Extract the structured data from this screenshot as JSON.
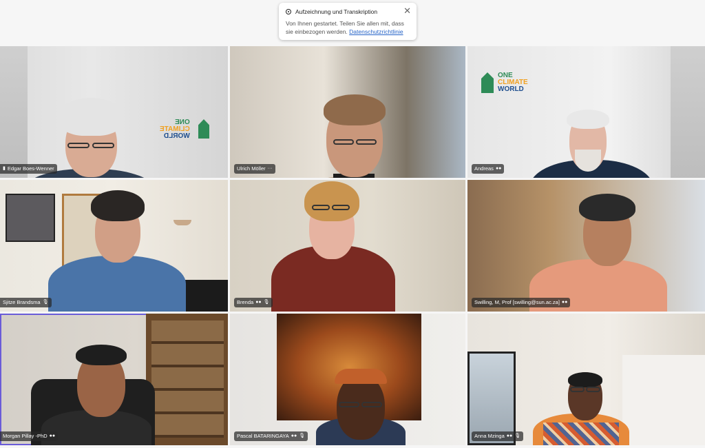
{
  "notification": {
    "title": "Aufzeichnung und Transkription",
    "body": "Von Ihnen gestartet. Teilen Sie allen mit, dass sie einbezogen werden.",
    "link": "Datenschutzrichtlinie"
  },
  "participants": [
    {
      "name": "Edgar Boes-Wenner"
    },
    {
      "name": "Ulrich Möller"
    },
    {
      "name": "Andreas"
    },
    {
      "name": "Sjitze Brandsma"
    },
    {
      "name": "Brenda"
    },
    {
      "name": "Swilling, M, Prof [swilling@sun.ac.za]"
    },
    {
      "name": "Morgan Pillay -PhD"
    },
    {
      "name": "Pascal BATARINGAYA"
    },
    {
      "name": "Anna Mzinga"
    }
  ],
  "logo": {
    "line1": "ONE",
    "line2": "CLIMATE",
    "line3": "WORLD"
  },
  "colors": {
    "active_border": "#6a5cd8",
    "link": "#2563c7"
  }
}
